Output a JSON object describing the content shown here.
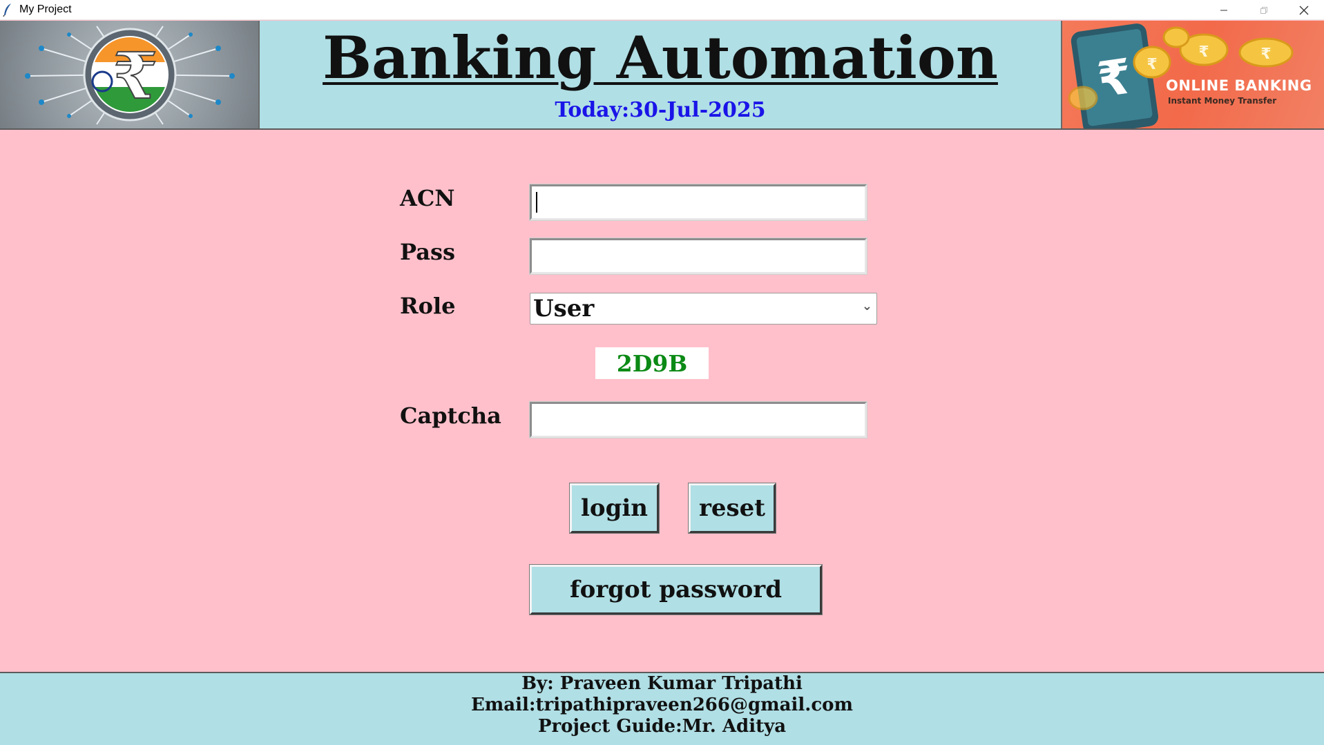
{
  "window": {
    "title": "My Project",
    "controls": [
      "minimize-icon",
      "restore-icon",
      "close-icon"
    ]
  },
  "header": {
    "title": "Banking Automation",
    "date_text": "Today:30-Jul-2025",
    "right_banner": {
      "heading": "ONLINE BANKING",
      "subheading": "Instant Money Transfer"
    }
  },
  "form": {
    "acn_label": "ACN",
    "acn_value": "",
    "pass_label": "Pass",
    "pass_value": "",
    "role_label": "Role",
    "role_selected": "User",
    "captcha_code": "2D9B",
    "captcha_label": "Captcha",
    "captcha_value": "",
    "login_label": "login",
    "reset_label": "reset",
    "forgot_label": "forgot password"
  },
  "footer": {
    "by": "By: Praveen Kumar Tripathi",
    "email": "Email:tripathipraveen266@gmail.com",
    "guide": "Project Guide:Mr. Aditya"
  },
  "colors": {
    "background": "#ffc0cb",
    "header_footer": "#b0dfe5",
    "date_text": "#1a14e8",
    "captcha_text": "#0b8a15"
  }
}
